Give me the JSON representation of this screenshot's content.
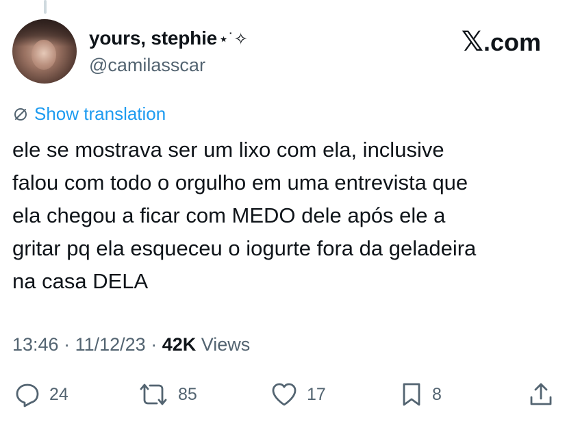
{
  "author": {
    "display_name": "yours, stephie",
    "name_decoration": "⋆˙✧",
    "handle": "@camilasscar"
  },
  "brand": {
    "mark": "𝕏",
    "suffix": ".com"
  },
  "translate": {
    "label": "Show translation",
    "icon": "translate-icon"
  },
  "tweet": {
    "text": "ele se mostrava ser um lixo com ela, inclusive\nfalou com todo o orgulho em uma entrevista que\nela chegou a ficar com MEDO dele após ele a\ngritar pq ela esqueceu o iogurte fora da geladeira\nna casa DELA"
  },
  "meta": {
    "time": "13:46",
    "separator": " · ",
    "date": "11/12/23",
    "views_count": "42K",
    "views_label": "Views"
  },
  "actions": {
    "replies": {
      "icon": "reply-icon",
      "count": "24"
    },
    "reposts": {
      "icon": "repost-icon",
      "count": "85"
    },
    "likes": {
      "icon": "heart-icon",
      "count": "17"
    },
    "bookmarks": {
      "icon": "bookmark-icon",
      "count": "8"
    },
    "share": {
      "icon": "share-icon"
    }
  },
  "colors": {
    "text": "#0f1419",
    "secondary": "#536471",
    "accent": "#1d9bf0"
  }
}
